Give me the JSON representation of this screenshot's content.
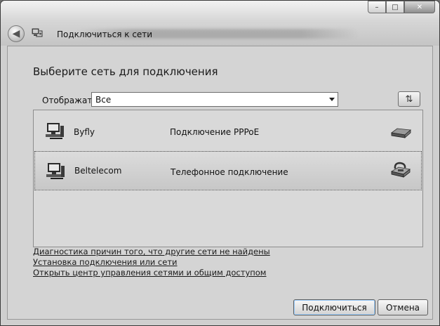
{
  "window": {
    "title": "Подключиться к сети",
    "caption_minimize": "–",
    "caption_maximize": "□",
    "caption_close": "✕",
    "back_glyph": "◀"
  },
  "main": {
    "heading": "Выберите сеть для подключения",
    "filter_label": "Отображать",
    "filter_value": "Все",
    "refresh_glyph": "⇅"
  },
  "networks": [
    {
      "name": "Byfly",
      "type": "Подключение PPPoE",
      "icon": "network-computer-icon",
      "device_icon": "broadband-modem-icon",
      "selected": false
    },
    {
      "name": "Beltelecom",
      "type": "Телефонное подключение",
      "icon": "network-computer-icon",
      "device_icon": "telephone-modem-icon",
      "selected": true
    }
  ],
  "links": [
    "Диагностика причин того, что другие сети не найдены",
    "Установка подключения или сети",
    "Открыть центр управления сетями и общим доступом"
  ],
  "buttons": {
    "connect": "Подключиться",
    "cancel": "Отмена"
  }
}
